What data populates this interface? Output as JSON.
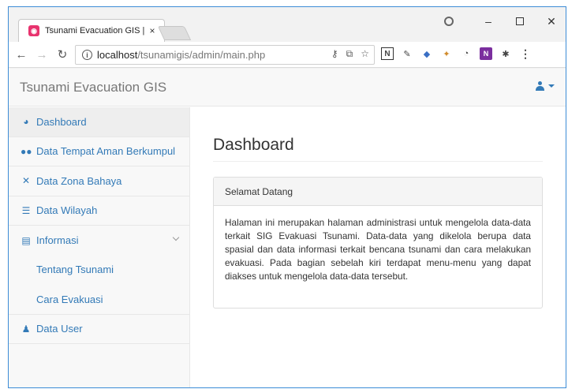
{
  "browser": {
    "tab_title": "Tsunami Evacuation GIS |",
    "tab_close": "×",
    "url_host": "localhost",
    "url_path": "/tsunamigis/admin/main.php",
    "window_controls": {
      "minimize": "–",
      "close": "✕"
    }
  },
  "navbar": {
    "brand": "Tsunami Evacuation GIS"
  },
  "sidebar": {
    "items": [
      {
        "label": "Dashboard",
        "icon": "dashboard-icon"
      },
      {
        "label": "Data Tempat Aman Berkumpul",
        "icon": "users-icon"
      },
      {
        "label": "Data Zona Bahaya",
        "icon": "fullscreen-icon"
      },
      {
        "label": "Data Wilayah",
        "icon": "list-icon"
      },
      {
        "label": "Informasi",
        "icon": "list-alt-icon"
      }
    ],
    "subitems": [
      {
        "label": "Tentang Tsunami"
      },
      {
        "label": "Cara Evakuasi"
      }
    ],
    "user_item": {
      "label": "Data User",
      "icon": "user-icon"
    }
  },
  "main": {
    "title": "Dashboard",
    "panel": {
      "heading": "Selamat Datang",
      "body": "Halaman ini merupakan halaman administrasi untuk mengelola data-data terkait SIG Evakuasi Tsunami. Data-data yang dikelola berupa data spasial dan data informasi terkait bencana tsunami dan cara melakukan evakuasi. Pada bagian sebelah kiri terdapat menu-menu yang dapat diakses untuk mengelola data-data tersebut."
    }
  },
  "colors": {
    "link": "#337ab7",
    "navbar_bg": "#f8f8f8",
    "window_border": "#3c8cd6"
  }
}
